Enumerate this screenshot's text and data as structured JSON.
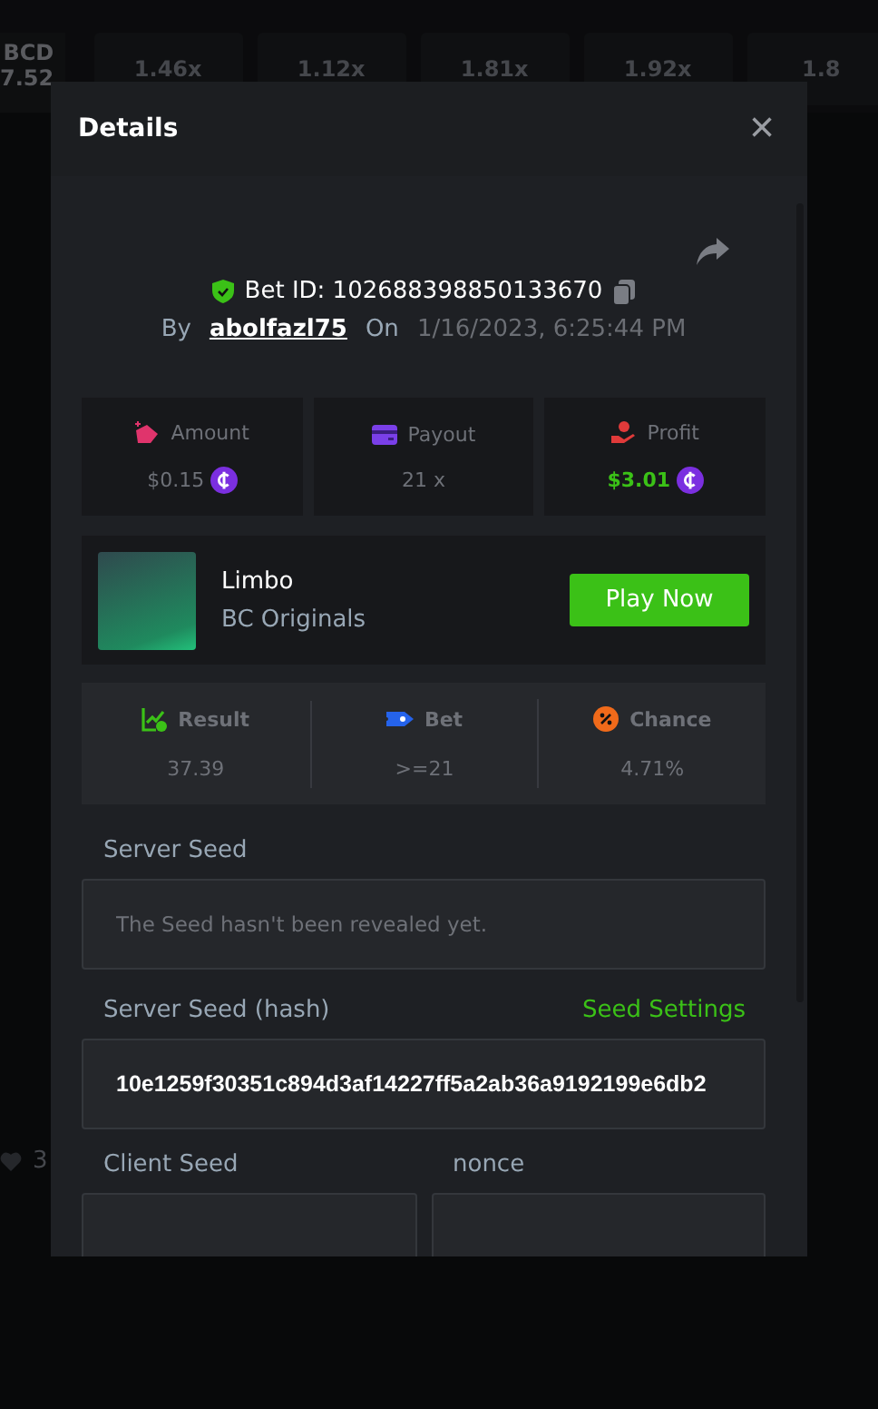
{
  "background": {
    "balance": {
      "currency": "BCD",
      "amount": "7.52"
    },
    "multipliers": [
      "1.46x",
      "1.12x",
      "1.81x",
      "1.92x",
      "1.8"
    ],
    "likes": "3"
  },
  "dialog": {
    "title": "Details",
    "close": "×",
    "bet": {
      "id_label": "Bet ID: 102688398850133670",
      "by_label": "By",
      "user": "abolfazl75",
      "on_label": "On",
      "date": "1/16/2023, 6:25:44 PM"
    },
    "stats": [
      {
        "kind": "amount",
        "label": "Amount",
        "value": "$0.15",
        "coin": true,
        "positive": false
      },
      {
        "kind": "payout",
        "label": "Payout",
        "value": "21 x",
        "coin": false,
        "positive": false
      },
      {
        "kind": "profit",
        "label": "Profit",
        "value": "$3.01",
        "coin": true,
        "positive": true
      }
    ],
    "game": {
      "name": "Limbo",
      "provider": "BC Originals",
      "button": "Play Now"
    },
    "results": [
      {
        "kind": "result",
        "label": "Result",
        "value": "37.39"
      },
      {
        "kind": "bet",
        "label": "Bet",
        "value": ">=21"
      },
      {
        "kind": "chance",
        "label": "Chance",
        "value": "4.71%"
      }
    ],
    "server_seed": {
      "label": "Server Seed",
      "placeholder": "The Seed hasn't been revealed yet."
    },
    "server_seed_hash": {
      "label": "Server Seed (hash)",
      "link": "Seed Settings",
      "value": "10e1259f30351c894d3af14227ff5a2ab36a9192199e6db2"
    },
    "client_seed": {
      "label": "Client Seed"
    },
    "nonce": {
      "label": "nonce"
    }
  }
}
